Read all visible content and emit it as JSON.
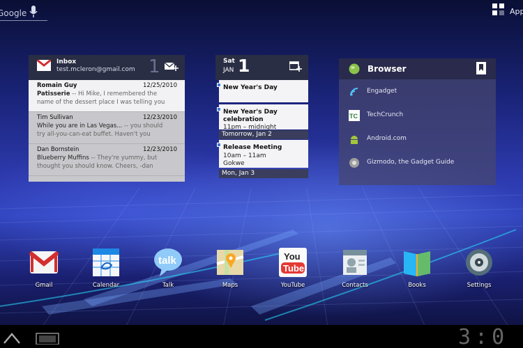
{
  "topbar": {
    "search_label": "Google",
    "apps_label": "Apps"
  },
  "gmail": {
    "title": "Inbox",
    "account": "test.mcleron@gmail.com",
    "unread_count": "1",
    "messages": [
      {
        "from": "Romain Guy",
        "date": "12/25/2010",
        "subject": "Patisserie",
        "snippet": " -- Hi Mike, I remembered the",
        "line3": "name of the dessert place I was telling you",
        "unread": true
      },
      {
        "from": "Tim Sullivan",
        "date": "12/23/2010",
        "subject": "While you are in Las Vegas...",
        "snippet": " -- you should",
        "line3": "try all-you-can-eat buffet. Haven't you",
        "unread": false
      },
      {
        "from": "Dan Bornstein",
        "date": "12/23/2010",
        "subject": "Blueberry Muffins",
        "snippet": " -- They're yummy, but",
        "line3": "thought you should know. Cheers, -dan",
        "unread": false
      }
    ]
  },
  "calendar": {
    "day_of_week": "Sat",
    "month": "JAN",
    "day": "1",
    "events": [
      {
        "title": "New Year's Day",
        "time": "",
        "location": ""
      },
      {
        "title": "New Year's Day celebration",
        "time": "11pm – midnight",
        "location": ""
      },
      {
        "title": "Release Meeting",
        "time": "10am – 11am",
        "location": "Gokwe"
      }
    ],
    "day_separators": [
      "Tomorrow, Jan 2",
      "Mon, Jan 3"
    ]
  },
  "bookmarks": {
    "title": "Browser",
    "items": [
      {
        "label": "Engadget",
        "icon": "engadget-icon"
      },
      {
        "label": "TechCrunch",
        "icon": "techcrunch-icon"
      },
      {
        "label": "Android.com",
        "icon": "android-icon"
      },
      {
        "label": "Gizmodo, the Gadget Guide",
        "icon": "gizmodo-icon"
      }
    ]
  },
  "dock": [
    {
      "label": "Gmail",
      "icon": "gmail-icon"
    },
    {
      "label": "Calendar",
      "icon": "calendar-icon"
    },
    {
      "label": "Talk",
      "icon": "talk-icon"
    },
    {
      "label": "Maps",
      "icon": "maps-icon"
    },
    {
      "label": "YouTube",
      "icon": "youtube-icon"
    },
    {
      "label": "Contacts",
      "icon": "contacts-icon"
    },
    {
      "label": "Books",
      "icon": "books-icon"
    },
    {
      "label": "Settings",
      "icon": "settings-icon"
    }
  ],
  "youtube_icon_text": {
    "top": "You",
    "bottom": "Tube"
  },
  "talk_icon_text": "talk",
  "clock": "3:0"
}
